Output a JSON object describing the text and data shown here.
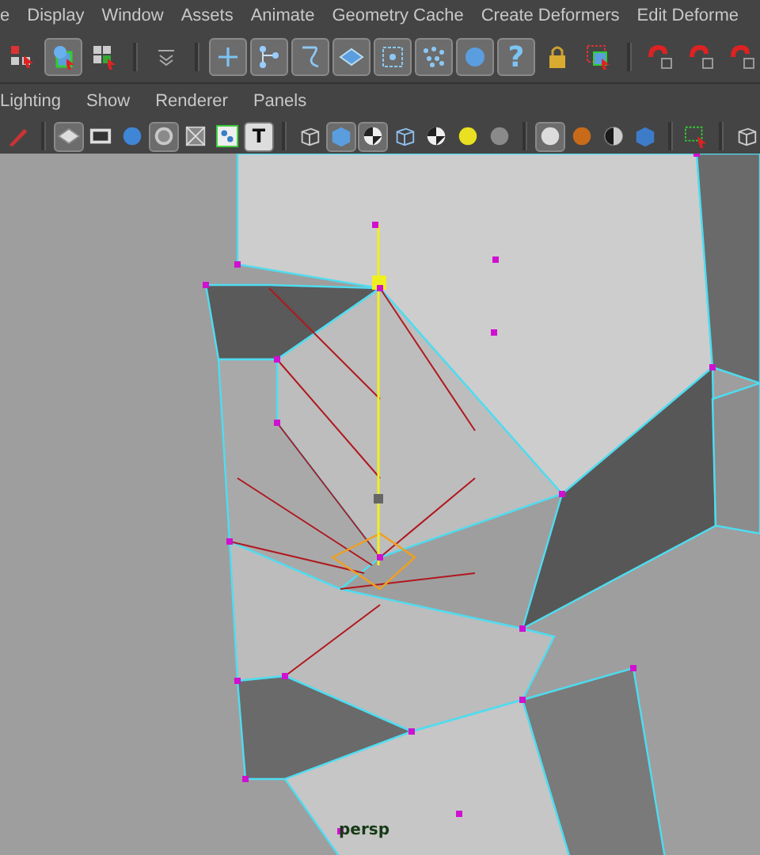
{
  "menu_bar": [
    "e",
    "Display",
    "Window",
    "Assets",
    "Animate",
    "Geometry Cache",
    "Create Deformers",
    "Edit Deforme"
  ],
  "status_line": {
    "help_label": "?",
    "tools": [
      {
        "selected": false
      },
      {
        "selected": true
      },
      {
        "selected": false
      },
      {
        "selected": false
      },
      {
        "selected": true
      },
      {
        "selected": true
      },
      {
        "selected": true
      },
      {
        "selected": true
      },
      {
        "selected": true
      },
      {
        "selected": true
      },
      {
        "selected": true
      },
      {
        "selected": true
      },
      {
        "selected": false
      },
      {
        "selected": false
      },
      {
        "selected": false
      },
      {
        "selected": false
      },
      {
        "selected": false
      }
    ]
  },
  "panel_menu": [
    "Lighting",
    "Show",
    "Renderer",
    "Panels"
  ],
  "panel_toolbar": {
    "text_label": "T",
    "tools": [
      {
        "selected": false
      },
      {
        "selected": true
      },
      {
        "selected": false
      },
      {
        "selected": false
      },
      {
        "selected": true
      },
      {
        "selected": false
      },
      {
        "selected": false
      },
      {
        "selected": false
      },
      {
        "selected": false
      },
      {
        "selected": true
      },
      {
        "selected": true
      },
      {
        "selected": false
      },
      {
        "selected": false
      },
      {
        "selected": false
      },
      {
        "selected": false
      },
      {
        "selected": true
      },
      {
        "selected": false
      },
      {
        "selected": false
      },
      {
        "selected": false
      },
      {
        "selected": false
      },
      {
        "selected": false
      }
    ]
  },
  "viewport": {
    "camera": "persp"
  }
}
